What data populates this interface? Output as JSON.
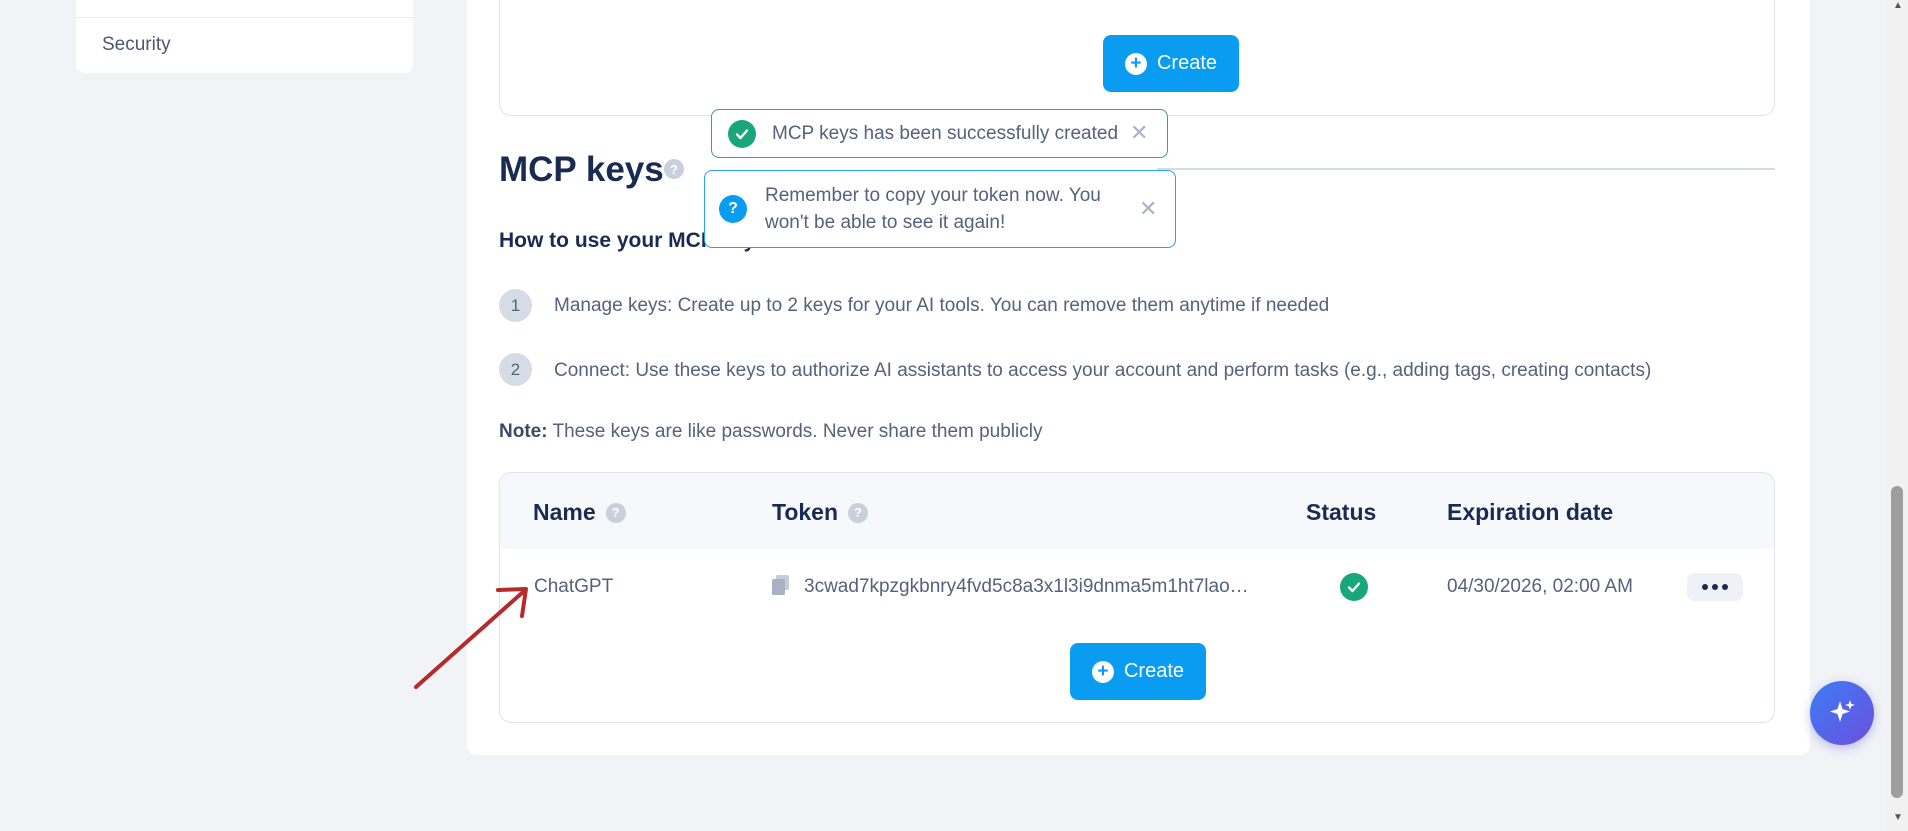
{
  "sidebar": {
    "items": [
      {
        "label": "Security"
      }
    ]
  },
  "top_section": {
    "create_label": "Create"
  },
  "mcp": {
    "title": "MCP keys",
    "howto_title": "How to use your MCP keys:",
    "steps": [
      {
        "num": "1",
        "text": "Manage keys: Create up to 2 keys for your AI tools. You can remove them anytime if needed"
      },
      {
        "num": "2",
        "text": "Connect: Use these keys to authorize AI assistants to access your account and perform tasks (e.g., adding tags, creating contacts)"
      }
    ],
    "note_label": "Note:",
    "note_text": "These keys are like passwords. Never share them publicly",
    "table": {
      "headers": {
        "name": "Name",
        "token": "Token",
        "status": "Status",
        "expiration": "Expiration date"
      },
      "rows": [
        {
          "name": "ChatGPT",
          "token": "3cwad7kpzgkbnry4fvd5c8a3x1l3i9dnma5m1ht7lao…",
          "status": "active",
          "expiration": "04/30/2026, 02:00 AM"
        }
      ]
    },
    "create_label": "Create"
  },
  "toasts": {
    "success": "MCP keys has been successfully created",
    "info_line1": "Remember to copy your token now. You",
    "info_line2": "won't be able to see it again!"
  },
  "icons": {
    "help": "question-circle-icon",
    "copy": "copy-icon",
    "status": "check-circle-icon",
    "more": "more-horizontal-icon",
    "fab": "sparkle-icon",
    "close": "close-icon"
  },
  "colors": {
    "primary": "#0a9cf0",
    "success": "#18a67a",
    "annotation": "#b52a2a"
  }
}
